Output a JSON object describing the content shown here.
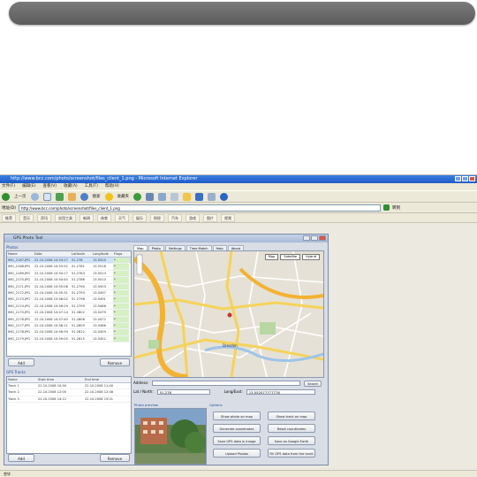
{
  "browser": {
    "title": "http://www.bcc.com/photo/screenshot/files_client_1.png - Microsoft Internet Explorer",
    "menu": [
      "文件(F)",
      "编辑(E)",
      "查看(V)",
      "收藏(A)",
      "工具(T)",
      "帮助(H)"
    ],
    "toolbar": {
      "back_label": "上一页",
      "search_label": "搜索",
      "favorites_label": "收藏夹"
    },
    "address_label": "地址(D)",
    "address_value": "http://www.bcc.com/photo/screenshot/files_client_1.png",
    "go_label": "转到",
    "links": [
      "推荐",
      "音乐",
      "资讯",
      "实用工具",
      "新闻",
      "体育",
      "天气",
      "娱乐",
      "财经",
      "汽车",
      "游戏",
      "图片",
      "视频"
    ],
    "status": "完毕"
  },
  "app": {
    "title": "GPS Photo Tool",
    "photos_group": "Photos",
    "columns": [
      "Name",
      "Date",
      "Latitude",
      "Longitude",
      "Flags"
    ],
    "rows": [
      [
        "IMG_2167.JPG",
        "22.10.2008 10:53:27",
        "51.278",
        "13.5520",
        "*"
      ],
      [
        "IMG_2168.JPG",
        "22.10.2008 10:53:52",
        "51.2781",
        "13.5518",
        "*"
      ],
      [
        "IMG_2169.JPG",
        "22.10.2008 10:54:17",
        "51.2783",
        "13.5514",
        "*"
      ],
      [
        "IMG_2170.JPG",
        "22.10.2008 10:54:45",
        "51.2786",
        "13.5510",
        "*"
      ],
      [
        "IMG_2171.JPG",
        "22.10.2008 10:55:08",
        "51.2790",
        "13.5503",
        "*"
      ],
      [
        "IMG_2172.JPG",
        "22.10.2008 10:55:31",
        "51.2793",
        "13.5497",
        "*"
      ],
      [
        "IMG_2173.JPG",
        "22.10.2008 10:56:02",
        "51.2796",
        "13.5491",
        "*"
      ],
      [
        "IMG_2174.JPG",
        "22.10.2008 10:56:29",
        "51.2799",
        "13.5486",
        "*"
      ],
      [
        "IMG_2175.JPG",
        "22.10.2008 10:57:14",
        "51.2802",
        "13.5479",
        "*"
      ],
      [
        "IMG_2176.JPG",
        "22.10.2008 10:57:40",
        "51.2806",
        "13.5472",
        "*"
      ],
      [
        "IMG_2177.JPG",
        "22.10.2008 10:58:11",
        "51.2809",
        "13.5466",
        "*"
      ],
      [
        "IMG_2178.JPG",
        "22.10.2008 10:58:39",
        "51.2812",
        "13.5459",
        "*"
      ],
      [
        "IMG_2179.JPG",
        "22.10.2008 10:59:05",
        "51.2815",
        "13.5452",
        "*"
      ]
    ],
    "add_button": "Add",
    "remove_button": "Remove",
    "track_group": "GPS Tracks",
    "track_columns": [
      "Name",
      "Start time",
      "End time"
    ],
    "track_rows": [
      [
        "Track 1",
        "22.10.2008 10:50",
        "22.10.2008 11:40"
      ],
      [
        "Track 2",
        "22.10.2008 12:05",
        "22.10.2008 12:48"
      ],
      [
        "Track 3",
        "22.10.2008 14:12",
        "22.10.2008 15:01"
      ]
    ],
    "track_add": "Add",
    "track_remove": "Remove",
    "tabs": [
      "Map",
      "Photo",
      "Settings",
      "Time Match",
      "Help",
      "About"
    ],
    "map_type_buttons": [
      "Map",
      "Satellite",
      "Hybrid"
    ],
    "map_city_label": "Dresden",
    "address_label": "Address:",
    "search_button": "Search",
    "lat_label": "Lat / North:",
    "lat_value": "51.278",
    "lon_label": "Long/East:",
    "lon_value": "13.552077777778",
    "preview_label": "Photo preview",
    "options_label": "Options",
    "option_buttons": [
      "Show photo on map",
      "Show track on map",
      "Generate coordinates",
      "Reset coordinates",
      "Save GPS data in image",
      "Save as Google Earth",
      "Upload Photos",
      "Fill GPS data from the track"
    ]
  }
}
